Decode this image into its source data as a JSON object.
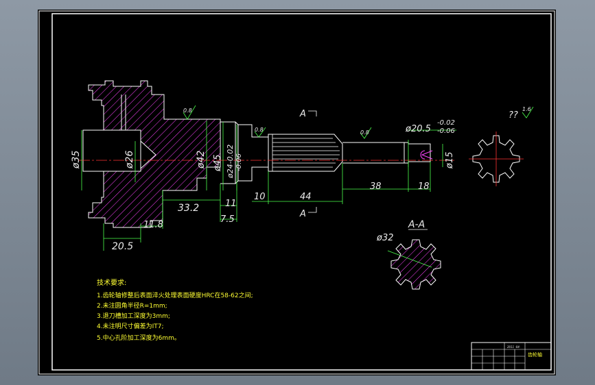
{
  "drawing": {
    "section_markers": {
      "top": "A",
      "bottom": "A",
      "section_title": "A-A"
    },
    "roughness": [
      "0.8",
      "0.8",
      "0.8",
      "1.6"
    ],
    "roughness_prefix": "??",
    "dimensions": {
      "d35": "ø35",
      "d26": "ø26",
      "d42": "ø42",
      "d45": "ø45",
      "d24": "ø24-0.02",
      "d24_tol": "-0.06",
      "d205": "ø20.5",
      "d205_tol_upper": "-0.02",
      "d205_tol_lower": "-0.06",
      "d15": "ø15",
      "d32": "ø32",
      "l332": "33.2",
      "l11": "11",
      "l75": "7.5",
      "l118": "11.8",
      "l205": "20.5",
      "l10": "10",
      "l44": "44",
      "l38": "38",
      "l18": "18"
    },
    "tech_requirements": {
      "title": "技术要求:",
      "items": [
        "1.齿轮轴修整后表面淬火处理表面硬度HRC在58-62之间;",
        "2.未注圆角半径R=1mm;",
        "3.退刀槽加工深度为3mm;",
        "4.未注明尺寸偏差为IT7;",
        "5.中心孔阶加工深度为6mm。"
      ]
    },
    "title_block": {
      "part_name": "齿轮轴",
      "small_label": "2011 ·04·"
    }
  },
  "colors": {
    "frame": "#ffffff",
    "section": "#ff44ff",
    "dimension": "#4dff4d",
    "center": "#ff3333",
    "text": "#ffff33",
    "background": "#000000"
  }
}
